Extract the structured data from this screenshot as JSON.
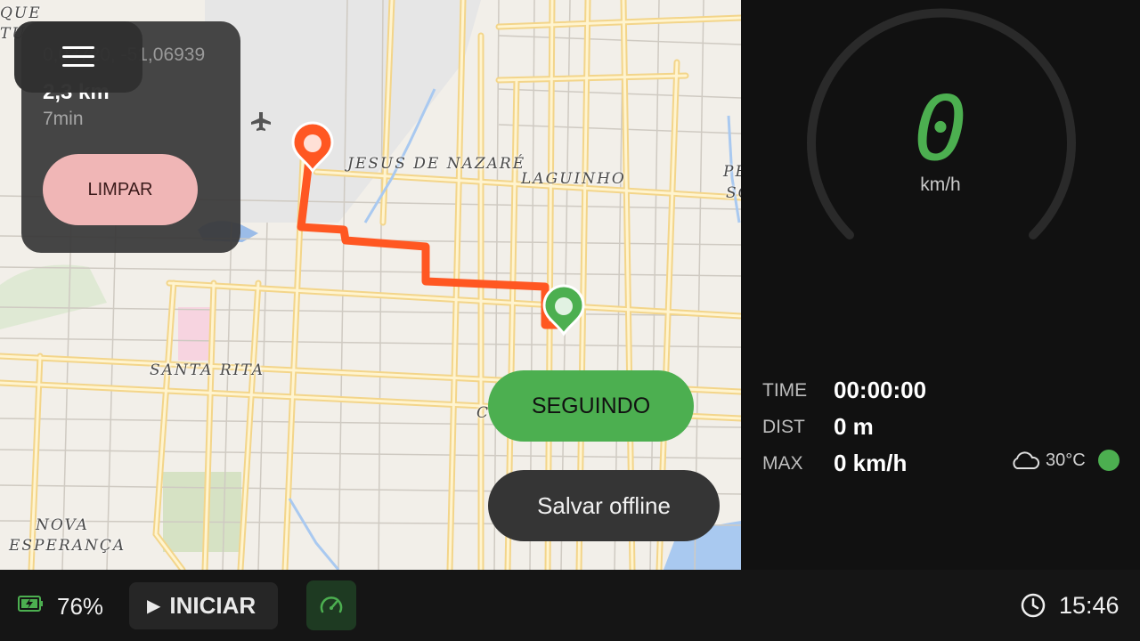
{
  "map": {
    "labels": [
      "JESUS DE NAZARÉ",
      "LAGUINHO",
      "SANTA RITA",
      "NOVA",
      "ESPERANÇA",
      "QUE",
      "TUAR",
      "PE",
      "SO",
      "C"
    ],
    "info": {
      "coordinates": "0,03720, -51,06939",
      "distance": "2,3 km",
      "duration": "7min",
      "clear_label": "LIMPAR"
    },
    "menu_icon": "hamburger-menu-icon",
    "following_label": "SEGUINDO",
    "offline_label": "Salvar offline"
  },
  "dashboard": {
    "speed": "0",
    "speed_unit": "km/h",
    "stats": {
      "time_label": "TIME",
      "time_value": "00:00:00",
      "dist_label": "DIST",
      "dist_value": "0 m",
      "max_label": "MAX",
      "max_value": "0 km/h"
    },
    "weather": {
      "icon": "cloud-icon",
      "temperature": "30°C",
      "status_color": "#4caf50"
    }
  },
  "bottom_bar": {
    "battery_icon": "battery-charging-icon",
    "battery_percent": "76%",
    "start_label": "INICIAR",
    "gauge_icon": "speedometer-icon",
    "clock_icon": "clock-icon",
    "time": "15:46"
  },
  "colors": {
    "accent_green": "#4caf50",
    "route_orange": "#ff5722",
    "clear_pink": "#f0b6b6"
  }
}
